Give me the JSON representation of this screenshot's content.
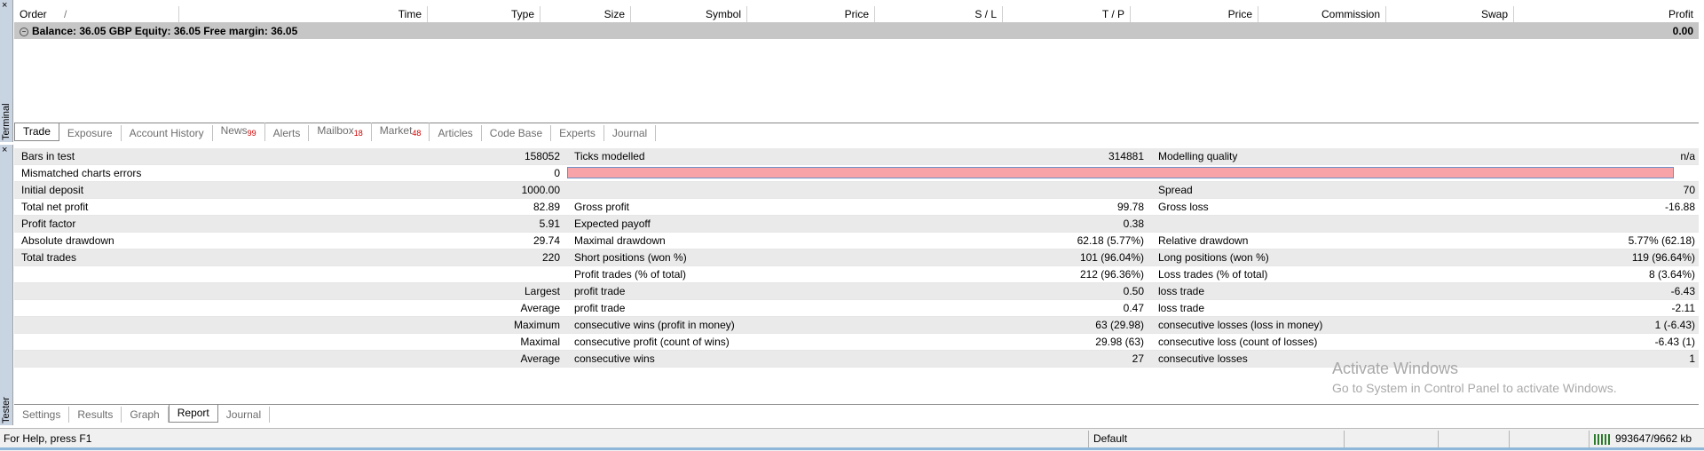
{
  "terminal": {
    "side_label": "Terminal",
    "close_symbol": "×",
    "columns": [
      "Order",
      "Time",
      "Type",
      "Size",
      "Symbol",
      "Price",
      "S / L",
      "T / P",
      "Price",
      "Commission",
      "Swap",
      "Profit"
    ],
    "sort_glyph": "/",
    "balance_text": "Balance: 36.05 GBP  Equity: 36.05  Free margin: 36.05",
    "profit_total": "0.00",
    "tabs": [
      {
        "label": "Trade",
        "badge": ""
      },
      {
        "label": "Exposure",
        "badge": ""
      },
      {
        "label": "Account History",
        "badge": ""
      },
      {
        "label": "News",
        "badge": "99"
      },
      {
        "label": "Alerts",
        "badge": ""
      },
      {
        "label": "Mailbox",
        "badge": "18"
      },
      {
        "label": "Market",
        "badge": "48"
      },
      {
        "label": "Articles",
        "badge": ""
      },
      {
        "label": "Code Base",
        "badge": ""
      },
      {
        "label": "Experts",
        "badge": ""
      },
      {
        "label": "Journal",
        "badge": ""
      }
    ]
  },
  "tester": {
    "side_label": "Tester",
    "close_symbol": "×",
    "report": [
      [
        "Bars in test",
        "158052",
        "Ticks modelled",
        "314881",
        "Modelling quality",
        "n/a"
      ],
      [
        "Mismatched charts errors",
        "0",
        "",
        "",
        "",
        ""
      ],
      [
        "Initial deposit",
        "1000.00",
        "",
        "",
        "Spread",
        "70"
      ],
      [
        "Total net profit",
        "82.89",
        "Gross profit",
        "99.78",
        "Gross loss",
        "-16.88"
      ],
      [
        "Profit factor",
        "5.91",
        "Expected payoff",
        "0.38",
        "",
        ""
      ],
      [
        "Absolute drawdown",
        "29.74",
        "Maximal drawdown",
        "62.18 (5.77%)",
        "Relative drawdown",
        "5.77% (62.18)"
      ],
      [
        "Total trades",
        "220",
        "Short positions (won %)",
        "101 (96.04%)",
        "Long positions (won %)",
        "119 (96.64%)"
      ],
      [
        "",
        "",
        "Profit trades (% of total)",
        "212 (96.36%)",
        "Loss trades (% of total)",
        "8 (3.64%)"
      ],
      [
        "",
        "Largest",
        "profit trade",
        "0.50",
        "loss trade",
        "-6.43"
      ],
      [
        "",
        "Average",
        "profit trade",
        "0.47",
        "loss trade",
        "-2.11"
      ],
      [
        "",
        "Maximum",
        "consecutive wins (profit in money)",
        "63 (29.98)",
        "consecutive losses (loss in money)",
        "1 (-6.43)"
      ],
      [
        "",
        "Maximal",
        "consecutive profit (count of wins)",
        "29.98 (63)",
        "consecutive loss (count of losses)",
        "-6.43 (1)"
      ],
      [
        "",
        "Average",
        "consecutive wins",
        "27",
        "consecutive losses",
        "1"
      ]
    ],
    "tabs": [
      "Settings",
      "Results",
      "Graph",
      "Report",
      "Journal"
    ],
    "active_tab": "Report",
    "watermark_title": "Activate Windows",
    "watermark_sub": "Go to System in Control Panel to activate Windows."
  },
  "status": {
    "help": "For Help, press F1",
    "profile": "Default",
    "memory": "993647/9662 kb"
  },
  "colors": {
    "quality_bar": "#f7a3a7",
    "badge": "#d40000",
    "shade_row": "#eaeaea",
    "side_strip": "#c9d4e3"
  }
}
